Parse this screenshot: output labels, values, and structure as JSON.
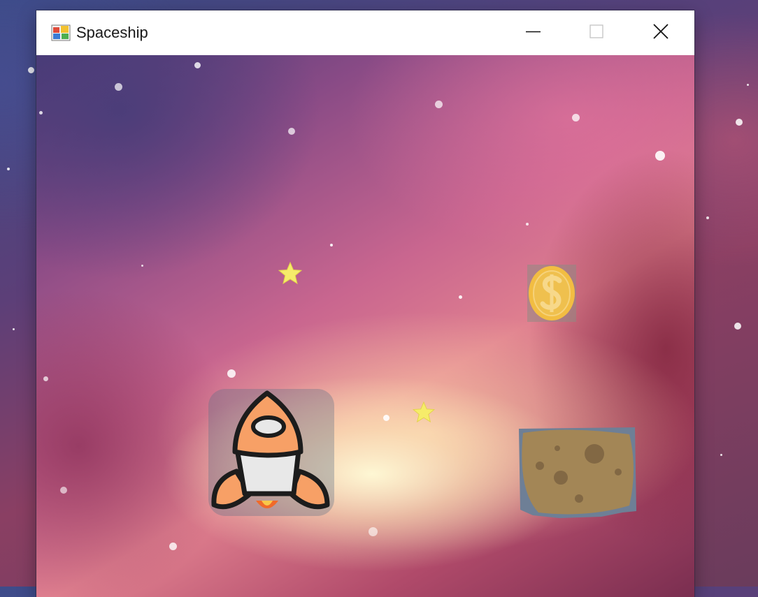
{
  "window": {
    "title": "Spaceship",
    "controls": {
      "minimize": "minimize-icon",
      "maximize": "maximize-icon",
      "close": "close-icon"
    }
  },
  "game": {
    "sprites": [
      "spaceship",
      "star",
      "star",
      "coin",
      "asteroid"
    ],
    "colors": {
      "ship_orange": "#f7a066",
      "ship_outline": "#1c1c1c",
      "ship_body": "#e8e8e8",
      "coin_gold": "#f2bd42",
      "star_yellow": "#f6ec6a",
      "asteroid_brown": "#a38656"
    }
  }
}
